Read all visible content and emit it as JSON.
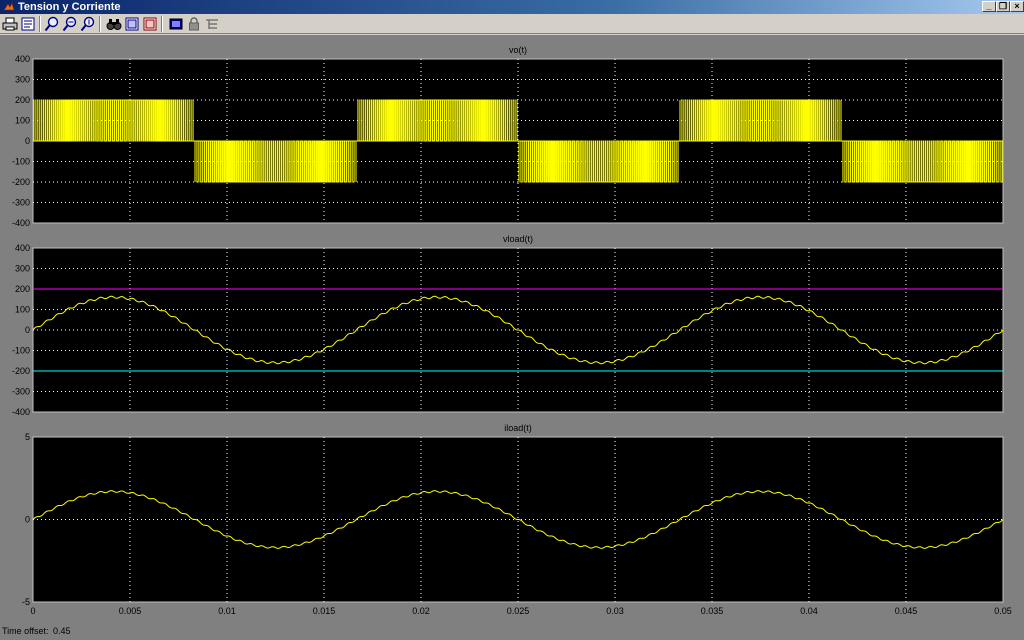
{
  "window": {
    "title": "Tension y Corriente",
    "controls": [
      "minimize",
      "restore",
      "close"
    ]
  },
  "toolbar": {
    "buttons": [
      "print-icon",
      "parameters-icon",
      "zoom-icon",
      "zoom-x-icon",
      "zoom-y-icon",
      "autoscale-icon",
      "save-axes-icon",
      "restore-axes-icon",
      "floating-scope-icon",
      "lock-icon",
      "signal-selection-icon"
    ]
  },
  "colors": {
    "background": "#808080",
    "axes": "#000000",
    "grid": "#ffffff",
    "trace": "#ffff00",
    "upper_limit": "#ff00ff",
    "lower_limit": "#00ffff"
  },
  "status": {
    "label": "Time offset:",
    "value": "0.45"
  },
  "chart_data": [
    {
      "type": "line",
      "title": "vo(t)",
      "xlim": [
        0,
        0.05
      ],
      "ylim": [
        -400,
        400
      ],
      "grid": true,
      "xticks": [
        0,
        0.005,
        0.01,
        0.015,
        0.02,
        0.025,
        0.03,
        0.035,
        0.04,
        0.045,
        0.05
      ],
      "yticks": [
        400,
        300,
        200,
        100,
        0,
        -100,
        -200,
        -300,
        -400
      ],
      "ytick_labels": [
        "400",
        "300",
        "200",
        "100",
        "0",
        "-100",
        "-200",
        "-300",
        "-400"
      ],
      "series": [
        {
          "color": "#ffff00",
          "pwm": {
            "levels": [
              200,
              0,
              -200
            ],
            "carrier_hz": 10000,
            "modulation": 0.8,
            "fundamental_hz": 60
          }
        }
      ]
    },
    {
      "type": "line",
      "title": "vload(t)",
      "xlim": [
        0,
        0.05
      ],
      "ylim": [
        -400,
        400
      ],
      "grid": true,
      "xticks": [
        0,
        0.005,
        0.01,
        0.015,
        0.02,
        0.025,
        0.03,
        0.035,
        0.04,
        0.045,
        0.05
      ],
      "yticks": [
        400,
        300,
        200,
        100,
        0,
        -100,
        -200,
        -300,
        -400
      ],
      "ytick_labels": [
        "400",
        "300",
        "200",
        "100",
        "0",
        "-100",
        "-200",
        "-300",
        "-400"
      ],
      "series": [
        {
          "color": "#ffff00",
          "sine": {
            "amplitude": 160,
            "frequency_hz": 60,
            "ripple": 5
          }
        },
        {
          "color": "#ff00ff",
          "constant": 200
        },
        {
          "color": "#00ffff",
          "constant": -200
        }
      ]
    },
    {
      "type": "line",
      "title": "iload(t)",
      "xlim": [
        0,
        0.05
      ],
      "ylim": [
        -5,
        5
      ],
      "grid": true,
      "xticks": [
        0,
        0.005,
        0.01,
        0.015,
        0.02,
        0.025,
        0.03,
        0.035,
        0.04,
        0.045,
        0.05
      ],
      "xtick_labels": [
        "0",
        "0.005",
        "0.01",
        "0.015",
        "0.02",
        "0.025",
        "0.03",
        "0.035",
        "0.04",
        "0.045",
        "0.05"
      ],
      "yticks": [
        5,
        0,
        -5
      ],
      "ytick_labels": [
        "5",
        "0",
        "-5"
      ],
      "series": [
        {
          "color": "#ffff00",
          "sine": {
            "amplitude": 1.7,
            "frequency_hz": 60,
            "ripple": 0.05
          }
        }
      ]
    }
  ]
}
